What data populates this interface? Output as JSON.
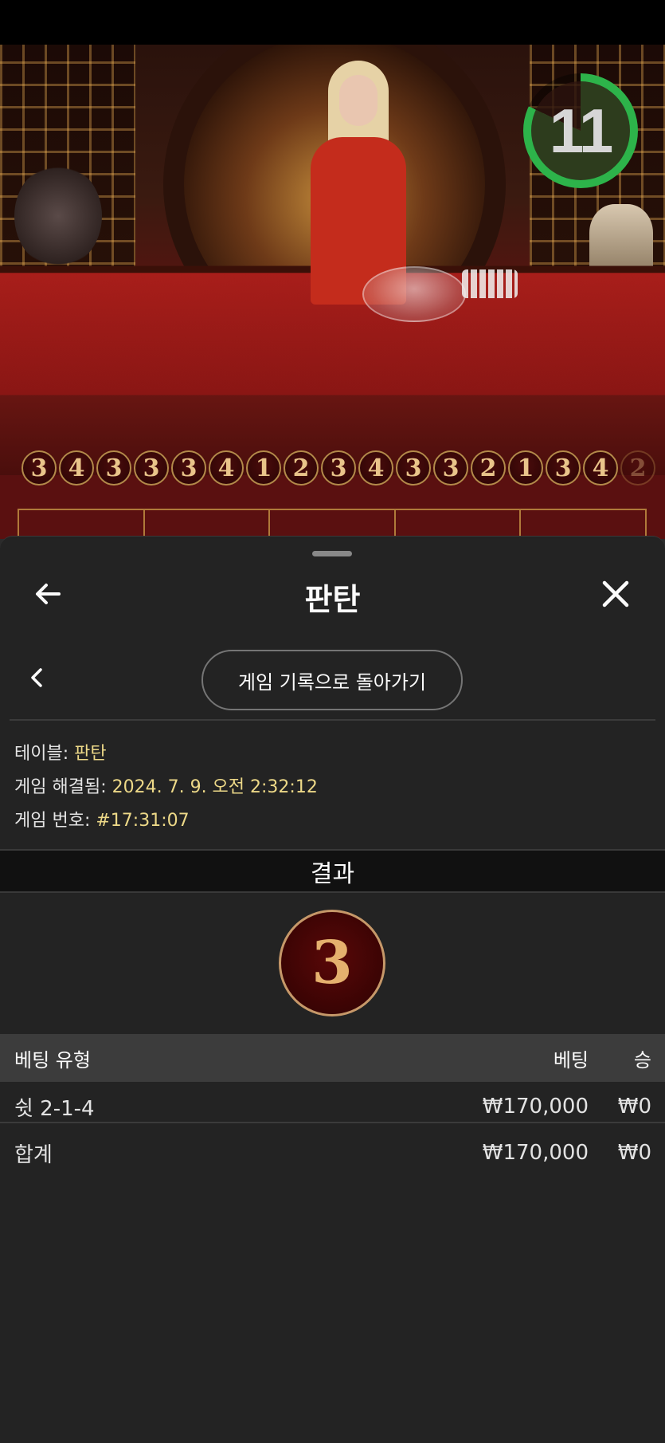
{
  "timer": {
    "value": "11",
    "remaining_fraction": 0.82,
    "color": "#2db34a"
  },
  "history_road": [
    "3",
    "4",
    "3",
    "3",
    "3",
    "4",
    "1",
    "2",
    "3",
    "4",
    "3",
    "3",
    "2",
    "1",
    "3",
    "4",
    "2"
  ],
  "sheet": {
    "title": "판탄",
    "back_to_history_label": "게임 기록으로 돌아가기",
    "info": {
      "table_label": "테이블:",
      "table_value": "판탄",
      "resolved_label": "게임 해결됨:",
      "resolved_value": "2024. 7. 9. 오전 2:32:12",
      "game_no_label": "게임 번호:",
      "game_no_value": "#17:31:07"
    },
    "result_header": "결과",
    "result_value": "3",
    "table": {
      "headers": {
        "type": "베팅 유형",
        "bet": "베팅",
        "win": "승"
      },
      "rows": [
        {
          "type": "쉿 2-1-4",
          "bet": "₩170,000",
          "win": "₩0"
        }
      ],
      "total": {
        "label": "합계",
        "bet": "₩170,000",
        "win": "₩0"
      }
    }
  },
  "icons": {
    "back": "arrow-left-icon",
    "close": "close-icon",
    "prev": "chevron-left-icon"
  },
  "colors": {
    "sheet_bg": "#232323",
    "info_value": "#f1dc8a",
    "ball_gold": "#e8b470",
    "accent_green": "#2db34a"
  }
}
